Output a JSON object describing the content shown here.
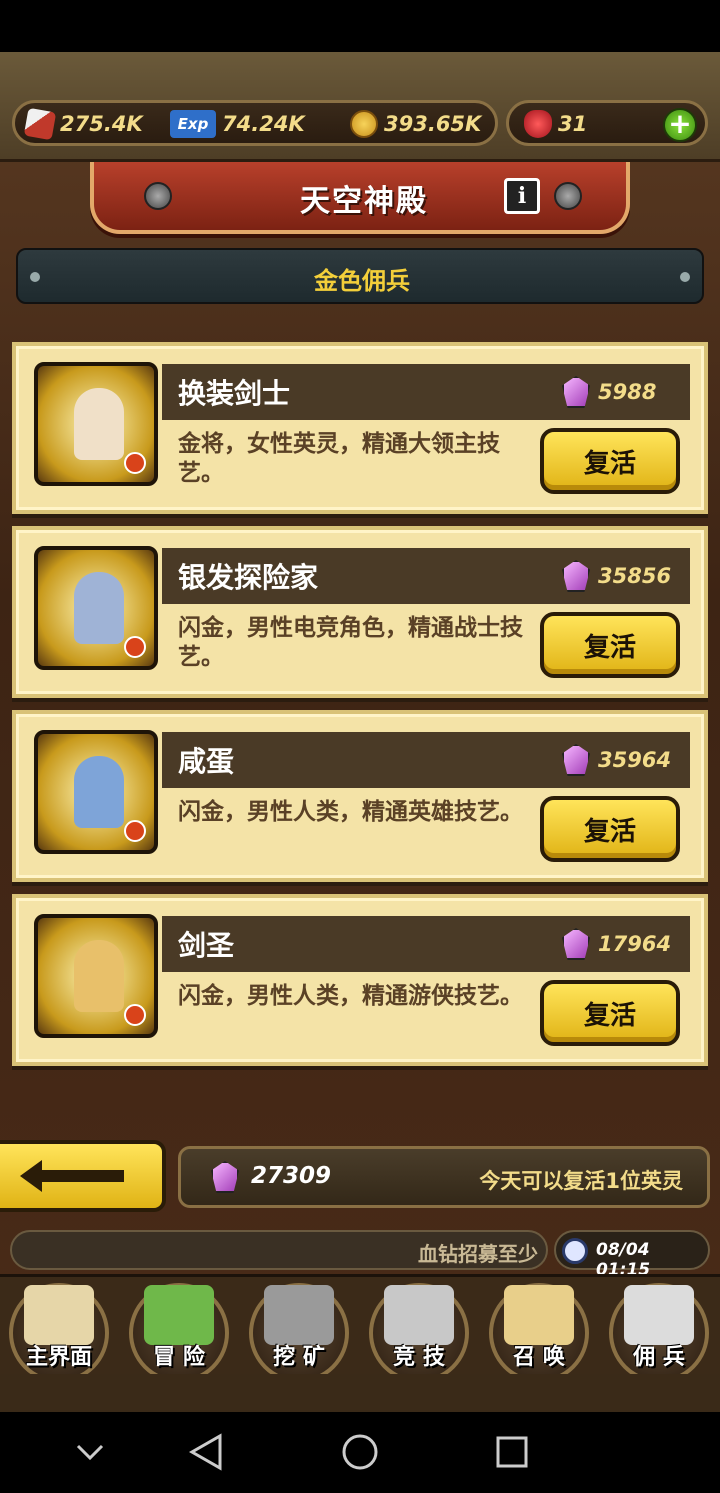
{
  "resources": {
    "attack": "275.4K",
    "exp": "74.24K",
    "gold": "393.65K",
    "ruby": "31"
  },
  "header": {
    "title": "天空神殿",
    "info_label": "i"
  },
  "subtitle": "金色佣兵",
  "heroes": [
    {
      "name": "换装剑士",
      "cost": "5988",
      "desc": "金将，女性英灵，精通大领主技艺。",
      "button": "复活",
      "color": "#f0e0c8"
    },
    {
      "name": "银发探险家",
      "cost": "35856",
      "desc": "闪金，男性电竞角色，精通战士技艺。",
      "button": "复活",
      "color": "#9fb3d6"
    },
    {
      "name": "咸蛋",
      "cost": "35964",
      "desc": "闪金，男性人类，精通英雄技艺。",
      "button": "复活",
      "color": "#7ea4d8"
    },
    {
      "name": "剑圣",
      "cost": "17964",
      "desc": "闪金，男性人类，精通游侠技艺。",
      "button": "复活",
      "color": "#e8c06a"
    }
  ],
  "footer": {
    "balance": "27309",
    "revive_note": "今天可以复活1位英灵"
  },
  "ticker": {
    "text": "血钻招募至少",
    "time": "08/04 01:15"
  },
  "nav": [
    "主界面",
    "冒 险",
    "挖 矿",
    "竞 技",
    "召 唤",
    "佣 兵"
  ],
  "colors": {
    "accent": "#e0b315",
    "banner": "#b8402b",
    "card": "#f4e3a7"
  }
}
